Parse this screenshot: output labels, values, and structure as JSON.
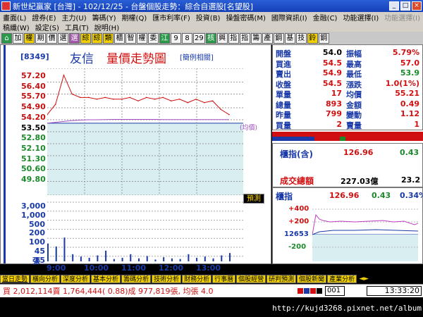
{
  "window": {
    "title": "新世紀贏家 [台灣] - 102/12/25 - 台盤個股走勢：綜合自選股[名望股]",
    "btn_min": "_",
    "btn_max": "□",
    "btn_close": "×"
  },
  "menu1": [
    "畫面(L)",
    "證券(E)",
    "主力(U)",
    "籌碼(Y)",
    "期權(Q)",
    "匯市利率(F)",
    "投資(B)",
    "操盤密碼(M)",
    "國際資訊(I)",
    "金融(C)",
    "功能選擇(I)",
    "功能選擇(I)"
  ],
  "menu2": [
    "稿纖(W)",
    "設定(S)",
    "工具(T)",
    "說明(H)"
  ],
  "toolbar": [
    "加",
    "權",
    "期",
    "價",
    "選",
    "選",
    "綜",
    "綜",
    "類",
    "櫃",
    "智",
    "權",
    "委",
    "江",
    "9",
    "8",
    "29",
    "核",
    "興",
    "指",
    "指",
    "籌",
    "產",
    "鋼",
    "基",
    "技",
    "鈴",
    "鋼"
  ],
  "chart": {
    "stock_code": "[8349]",
    "stock_name": "友信",
    "title": "量價走勢圖",
    "related_button": "[簡例相關]",
    "avg_tag": "(均價)",
    "predict_button": "預測",
    "volume_unit": "張"
  },
  "chart_data": {
    "type": "line",
    "price_ticks": [
      "57.20",
      "56.40",
      "55.70",
      "54.90",
      "54.20",
      "53.50",
      "52.80",
      "52.10",
      "51.30",
      "50.60",
      "49.80"
    ],
    "volume_ticks": [
      "3,000",
      "1,000",
      "500",
      "200",
      "100",
      "45",
      "15"
    ],
    "time_ticks": [
      "9:00",
      "10:00",
      "11:00",
      "12:00",
      "13:00"
    ],
    "open_price": 54.0,
    "ylim": [
      49.8,
      57.2
    ],
    "x": [
      "9:00",
      "9:08",
      "9:10",
      "9:15",
      "9:20",
      "9:30",
      "9:45",
      "10:00",
      "10:15",
      "10:30",
      "10:45",
      "11:00",
      "11:15",
      "11:30",
      "11:45",
      "12:00",
      "12:15",
      "12:30",
      "12:45",
      "13:00",
      "13:15",
      "13:25",
      "13:30"
    ],
    "series": [
      {
        "values": [
          54.5,
          55.1,
          56.8,
          55.7,
          55.5,
          55.5,
          55.4,
          55.5,
          55.4,
          55.4,
          55.5,
          55.3,
          55.5,
          55.4,
          55.5,
          55.3,
          55.4,
          55.2,
          55.4,
          55.2,
          55.3,
          54.8,
          54.5
        ]
      },
      {
        "values": [
          54.0,
          54.05,
          54.1,
          54.15,
          54.18,
          54.2,
          54.2,
          54.21,
          54.22,
          54.22,
          54.22,
          54.22,
          54.22,
          54.22,
          54.21,
          54.21,
          54.21,
          54.21,
          54.21,
          54.21,
          54.21,
          54.21,
          54.21
        ]
      }
    ],
    "volume": [
      30,
      25,
      40,
      12,
      8,
      6,
      10,
      18,
      4,
      6,
      12,
      5,
      9,
      3,
      7,
      5,
      4,
      12,
      6,
      8,
      5,
      10,
      14
    ],
    "grid": true
  },
  "quote": {
    "rows": [
      {
        "l1": "開盤",
        "v1": "54.0",
        "c1": "black",
        "l2": "振幅",
        "v2": "5.79%",
        "c2": "red"
      },
      {
        "l1": "買進",
        "v1": "54.5",
        "c1": "red",
        "l2": "最高",
        "v2": "57.0",
        "c2": "red"
      },
      {
        "l1": "賣出",
        "v1": "54.9",
        "c1": "red",
        "l2": "最低",
        "v2": "53.9",
        "c2": "green"
      },
      {
        "l1": "收盤",
        "v1": "54.5",
        "c1": "red",
        "l2": "漲跌",
        "v2": "1.0(1%)",
        "c2": "red"
      },
      {
        "l1": "單量",
        "v1": "17",
        "c1": "red",
        "l2": "均價",
        "v2": "55.21",
        "c2": "red"
      },
      {
        "l1": "總量",
        "v1": "893",
        "c1": "red",
        "l2": "金額",
        "v2": "0.49",
        "c2": "red"
      },
      {
        "l1": "昨量",
        "v1": "799",
        "c1": "red",
        "l2": "變動",
        "v2": "1.12",
        "c2": "red"
      },
      {
        "l1": "買量",
        "v1": "2",
        "c1": "red",
        "l2": "賣量",
        "v2": "1",
        "c2": "red"
      }
    ]
  },
  "index": {
    "label": "櫃指(含)",
    "value": "126.96",
    "change": "0.43",
    "turnover_label": "成交總額",
    "turnover": "227.03億",
    "turnover2": "23.2"
  },
  "mini": {
    "title": "櫃指",
    "v1": "126.96",
    "v2": "0.43",
    "v3": "0.34%",
    "ticks": [
      "+400",
      "+200",
      "12653",
      "-200"
    ]
  },
  "tabs": [
    "當日走勢",
    "橫向分析",
    "深度分析",
    "基本分析",
    "籌碼分析",
    "技術分析",
    "財務分析",
    "行事曆",
    "個股經營",
    "研判預測",
    "個股新聞",
    "產業分析"
  ],
  "status": {
    "text": "買 2,012,114賣 1,764,444( 0.88)成 977,819張, 均張 4.0",
    "box": "001",
    "time": "13:33:20"
  },
  "url": "http://kujd3268.pixnet.net/album",
  "colors": {
    "up": "#d01010",
    "down": "#1a8a2a",
    "avg": "#a050c0",
    "volume": "#1a3aa8",
    "fill": "#d8eef0"
  }
}
